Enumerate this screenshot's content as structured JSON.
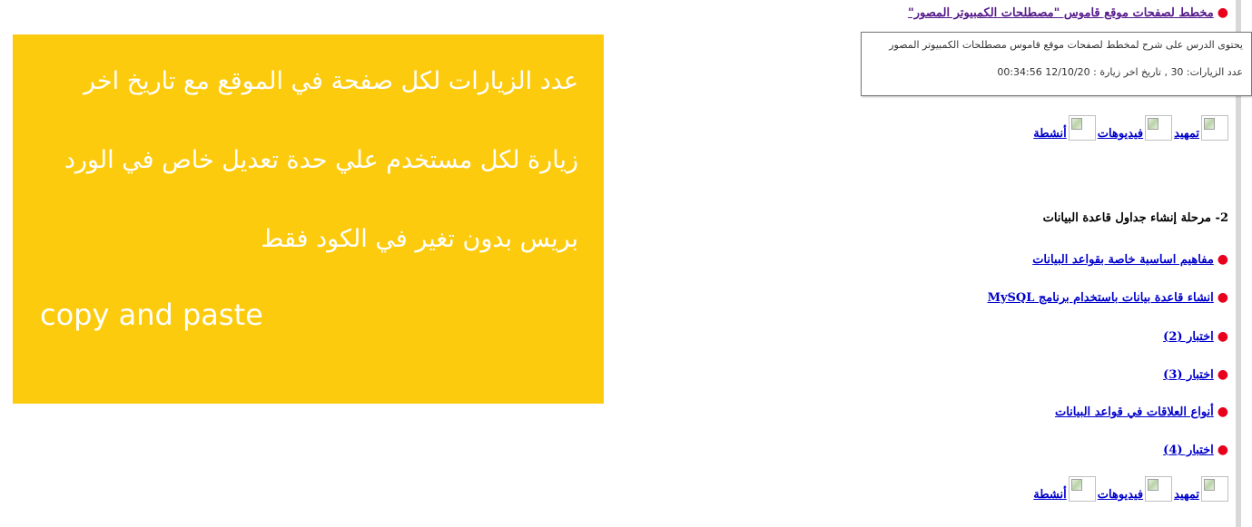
{
  "promo": {
    "arabic_text": "عدد الزيارات لكل صفحة في الموقع مع تاريخ اخر زيارة لكل مستخدم علي حدة تعديل خاص في الورد بريس بدون تغير في الكود فقط",
    "english_text": "copy and paste",
    "background": "#fdcb0e",
    "text_color": "#ffffff"
  },
  "lessons": {
    "top_link": "مخطط لصفحات موقع قاموس \"مصطلحات الكمبيوتر المصور\"",
    "tooltip": {
      "line1": "يحتوى الدرس على شرح لمخطط لصفحات موقع قاموس مصطلحات الكمبيوتر المصور",
      "line2": "عدد الزيارات: 30 , تاريخ اخر زيارة : 12/10/20 00:34:56"
    },
    "media_row_1": {
      "intro": "تمهيد",
      "videos": "فيديوهات",
      "activities": "أنشطة"
    },
    "section_heading": "2- مرحلة إنشاء جداول قاعدة البيانات",
    "items": [
      {
        "label": "مفاهيم اساسية خاصة بقواعد البيانات"
      },
      {
        "label": "انشاء قاعدة بيانات باستخدام برنامج MySQL"
      },
      {
        "label": "اختبار (2)"
      },
      {
        "label": "اختبار (3)"
      },
      {
        "label": "أنواع العلاقات في قواعد البيانات"
      },
      {
        "label": "اختبار (4)"
      }
    ],
    "media_row_2": {
      "intro": "تمهيد",
      "videos": "فيديوهات",
      "activities": "أنشطة"
    },
    "bullet": "●",
    "bullet_color": "#e8001c",
    "link_color": "#0000cc"
  }
}
